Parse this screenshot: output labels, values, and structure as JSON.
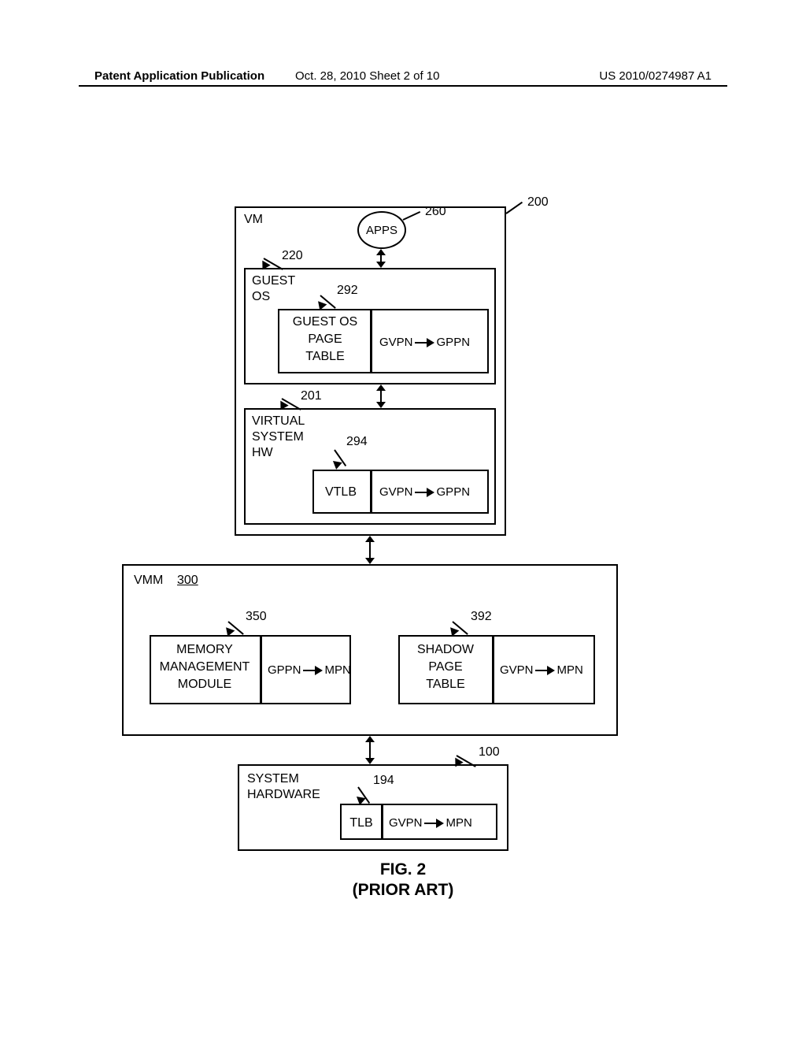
{
  "header": {
    "left": "Patent Application Publication",
    "center": "Oct. 28, 2010  Sheet 2 of 10",
    "right": "US 2010/0274987 A1"
  },
  "refs": {
    "vm": "200",
    "apps": "260",
    "guest_os": "220",
    "guest_page_table": "292",
    "vsys_hw": "201",
    "vtlb": "294",
    "vmm": "300",
    "mem_mgmt": "350",
    "shadow_pt": "392",
    "sys_hw": "100",
    "tlb": "194"
  },
  "labels": {
    "vm": "VM",
    "vmm": "VMM",
    "apps": "APPS",
    "guest_os_l1": "GUEST",
    "guest_os_l2": "OS",
    "gpt_l1": "GUEST OS",
    "gpt_l2": "PAGE",
    "gpt_l3": "TABLE",
    "vsys_l1": "VIRTUAL",
    "vsys_l2": "SYSTEM",
    "vsys_l3": "HW",
    "vtlb": "VTLB",
    "mem_l1": "MEMORY",
    "mem_l2": "MANAGEMENT",
    "mem_l3": "MODULE",
    "spt_l1": "SHADOW",
    "spt_l2": "PAGE",
    "spt_l3": "TABLE",
    "sys_l1": "SYSTEM",
    "sys_l2": "HARDWARE",
    "tlb": "TLB"
  },
  "mappings": {
    "gvpn": "GVPN",
    "gppn": "GPPN",
    "mpn": "MPN"
  },
  "caption": {
    "fig": "FIG. 2",
    "sub": "(PRIOR ART)"
  }
}
